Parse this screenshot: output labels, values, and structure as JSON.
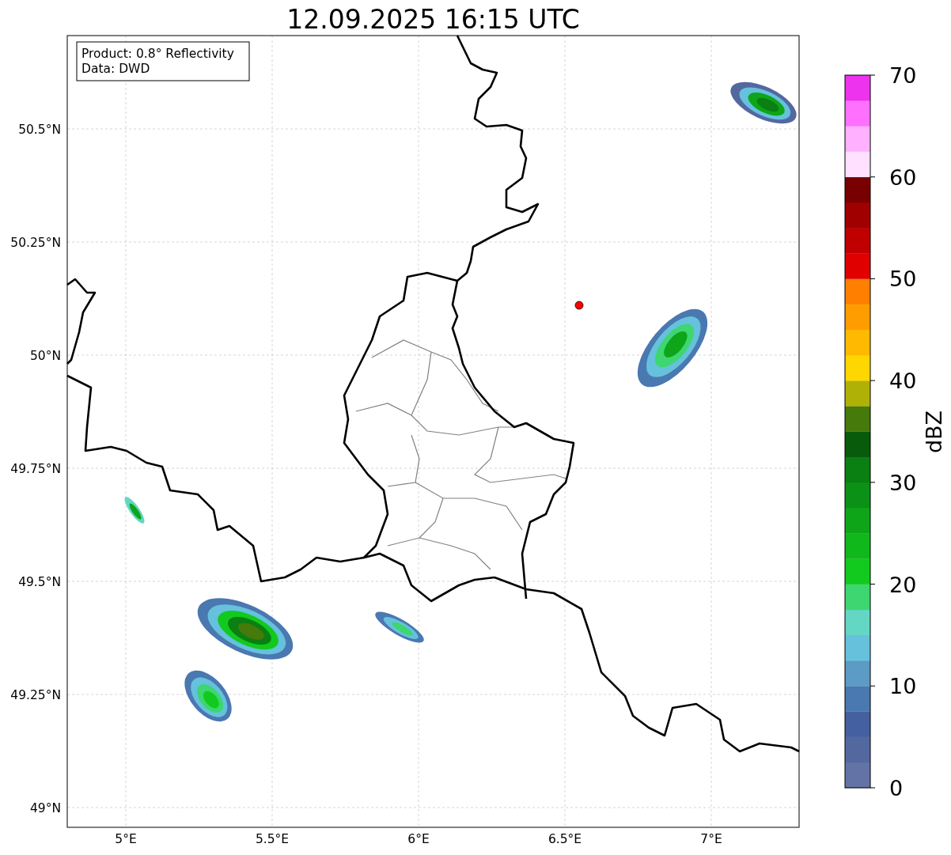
{
  "title": "12.09.2025 16:15 UTC",
  "info": [
    "Product: 0.8° Reflectivity",
    "Data: DWD"
  ],
  "lat_ticks": [
    "50.5°N",
    "50.25°N",
    "50°N",
    "49.75°N",
    "49.5°N",
    "49.25°N",
    "49°N"
  ],
  "lon_ticks": [
    "5°E",
    "5.5°E",
    "6°E",
    "6.5°E",
    "7°E"
  ],
  "colorbar": {
    "label": "dBZ",
    "ticks": [
      "70",
      "60",
      "50",
      "40",
      "30",
      "20",
      "10",
      "0"
    ],
    "bins": [
      {
        "color": "#6473a5"
      },
      {
        "color": "#5468a0"
      },
      {
        "color": "#4560a0"
      },
      {
        "color": "#4a78b0"
      },
      {
        "color": "#5b9bc4"
      },
      {
        "color": "#66c1dc"
      },
      {
        "color": "#63d6c4"
      },
      {
        "color": "#3dd670"
      },
      {
        "color": "#12c91e"
      },
      {
        "color": "#10b81c"
      },
      {
        "color": "#0ea518"
      },
      {
        "color": "#0b9216"
      },
      {
        "color": "#0a7f12"
      },
      {
        "color": "#075b0b"
      },
      {
        "color": "#467a0a"
      },
      {
        "color": "#b0b106"
      },
      {
        "color": "#ffd700"
      },
      {
        "color": "#ffb900"
      },
      {
        "color": "#ff9d00"
      },
      {
        "color": "#ff8000"
      },
      {
        "color": "#e00000"
      },
      {
        "color": "#c00000"
      },
      {
        "color": "#a00000"
      },
      {
        "color": "#780000"
      },
      {
        "color": "#ffe0ff"
      },
      {
        "color": "#ffb0ff"
      },
      {
        "color": "#ff70ff"
      },
      {
        "color": "#ee33ee"
      }
    ]
  }
}
